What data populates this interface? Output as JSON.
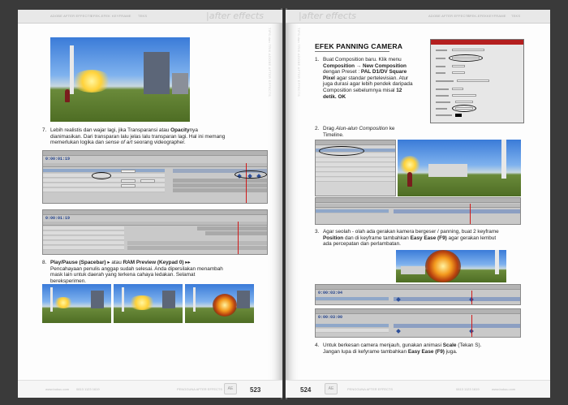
{
  "left_page": {
    "header_tabs": [
      "ADOBE AFTER EFFECTS",
      "EFEK-EFEK",
      "KEYFRAME",
      "TEKS"
    ],
    "header_logo": "|after effects",
    "side_text": "TIPS dan TRIK ADOBE AFTER EFFECTS",
    "page_number": "523",
    "footer_site": "www.bukuu.com",
    "footer_phone": "0813 1123 1619",
    "footer_mid": "PENGGUNA AFTER EFFECTS",
    "step7_number": "7.",
    "step7_line1_pre": "Lebih realistis dan wajar lagi, jika Transparansi atau ",
    "step7_line1_bold": "Opacity",
    "step7_line1_post": "nya",
    "step7_line2": "dianimasikan. Dari transparan lalu jelas lalu transparan lagi. Hal ini memang",
    "step7_line3_pre": "memerlukan logika dan ",
    "step7_line3_italic": "sense of art",
    "step7_line3_post": " seorang videographer.",
    "step8_number": "8.",
    "step8_bold1": "Play/Pause (Spacebar)",
    "step8_mid": " atau ",
    "step8_bold2": "RAM Preview (Keypad 0)",
    "step8_line2": "Pencahayaan penulis anggap sudah selesai. Anda dipersilakan menambah",
    "step8_line3": "mask lain untuk daerah yang terkena cahaya ledakan. Selamat",
    "step8_line4": "bereksperimen.",
    "timeline1_time": "0:00:01:19",
    "timeline2_time": "0:00:01:19"
  },
  "right_page": {
    "header_tabs": [
      "ADOBE AFTER EFFECTS",
      "EFEK-EFEK",
      "KEYFRAME",
      "TEKS"
    ],
    "header_logo": "|after effects",
    "side_text": "TIPS dan TRIK ADOBE AFTER EFFECTS",
    "page_number": "524",
    "footer_site": "www.bukuu.com",
    "footer_phone": "0813 1123 1619",
    "footer_mid": "PENGGUNA AFTER EFFECTS",
    "section_title": "EFEK PANNING CAMERA",
    "step1_number": "1.",
    "step1_l1": "Buat Composition baru. Klik menu",
    "step1_l2_bold": "Composition → New Composition",
    "step1_l3_pre": "dengan Preset : ",
    "step1_l3_bold": "PAL D1/DV Square",
    "step1_l4_bold": "Pixel",
    "step1_l4_post": " agar standar pertelevisian. Atur",
    "step1_l5": "juga durasi agar lebih pendek daripada",
    "step1_l6_pre": "Composition sebelumnya misal ",
    "step1_l6_bold": "12",
    "step1_l7_bold": "detik. OK",
    "step2_number": "2.",
    "step2_l1_pre": "Drag ",
    "step2_l1_italic": "Alun-alun Composition",
    "step2_l1_post": " ke",
    "step2_l2": "Timeline.",
    "step3_number": "3.",
    "step3_l1": "Agar seolah - olah ada gerakan kamera bergeser / panning, buat 2 keyframe",
    "step3_l2_bold1": "Position",
    "step3_l2_mid": " dan di keyframe tambahkan ",
    "step3_l2_bold2": "Easy Ease (F9)",
    "step3_l2_post": " agar gerakan lembut",
    "step3_l3": "ada percepatan dan perlambatan.",
    "step4_number": "4.",
    "step4_l1_pre": "Untuk berkesan camera menjauh, gunakan animasi ",
    "step4_l1_bold": "Scale",
    "step4_l1_post": " (Tekan S).",
    "step4_l2_pre": "Jangan lupa di kefyrame tambahkan ",
    "step4_l2_bold": "Easy Ease (F9)",
    "step4_l2_post": " juga.",
    "timeline3_time": "0:00:03:04",
    "timeline4_time": "0:00:03:00"
  }
}
